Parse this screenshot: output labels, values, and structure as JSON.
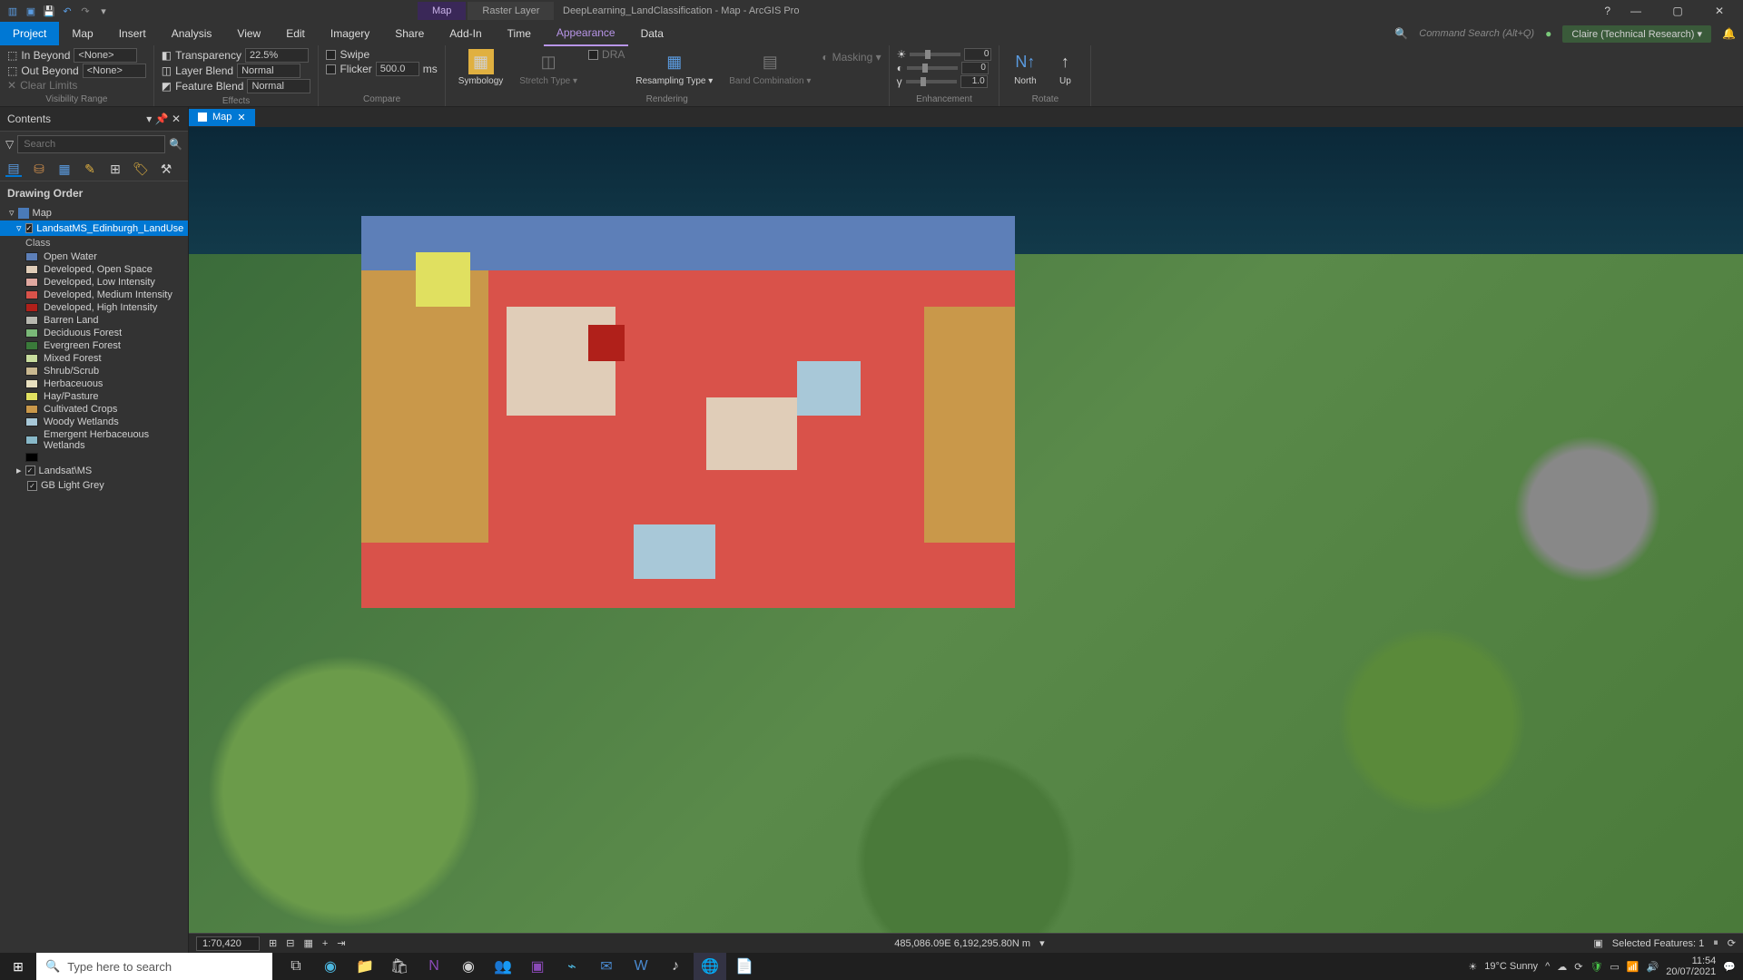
{
  "title": "DeepLearning_LandClassification - Map - ArcGIS Pro",
  "context_tabs": {
    "map": "Map",
    "raster": "Raster Layer"
  },
  "help_icon": "?",
  "user": "Claire (Technical Research) ▾",
  "command_search_placeholder": "Command Search (Alt+Q)",
  "menus": {
    "project": "Project",
    "map": "Map",
    "insert": "Insert",
    "analysis": "Analysis",
    "view": "View",
    "edit": "Edit",
    "imagery": "Imagery",
    "share": "Share",
    "addin": "Add-In",
    "time": "Time",
    "appearance": "Appearance",
    "data": "Data"
  },
  "ribbon": {
    "visibility": {
      "in_beyond": "In Beyond",
      "out_beyond": "Out Beyond",
      "none": "<None>",
      "clear": "Clear Limits",
      "group": "Visibility Range"
    },
    "effects": {
      "transparency": "Transparency",
      "transparency_val": "22.5%",
      "layer_blend": "Layer Blend",
      "feature_blend": "Feature Blend",
      "normal": "Normal",
      "group": "Effects"
    },
    "compare": {
      "swipe": "Swipe",
      "flicker": "Flicker",
      "flicker_val": "500.0",
      "ms": "ms",
      "group": "Compare"
    },
    "rendering": {
      "symbology": "Symbology",
      "stretch": "Stretch Type ▾",
      "dra": "DRA",
      "resampling": "Resampling Type ▾",
      "band": "Band Combination ▾",
      "masking": "Masking ▾",
      "group": "Rendering"
    },
    "enhancement": {
      "brightness": "0",
      "contrast": "0",
      "gamma": "1.0",
      "group": "Enhancement"
    },
    "rotate": {
      "north": "North",
      "up": "Up",
      "group": "Rotate"
    }
  },
  "contents": {
    "title": "Contents",
    "search_placeholder": "Search",
    "drawing_order": "Drawing Order",
    "map_node": "Map",
    "layer_selected": "LandsatMS_Edinburgh_LandUse",
    "class_header": "Class",
    "legend": [
      {
        "label": "Open Water",
        "color": "#5d7fb8"
      },
      {
        "label": "Developed, Open Space",
        "color": "#e0cdb8"
      },
      {
        "label": "Developed, Low Intensity",
        "color": "#e0a8a0"
      },
      {
        "label": "Developed, Medium Intensity",
        "color": "#d9524a"
      },
      {
        "label": "Developed, High Intensity",
        "color": "#b0201a"
      },
      {
        "label": "Barren Land",
        "color": "#b8b8b0"
      },
      {
        "label": "Deciduous Forest",
        "color": "#7ab878"
      },
      {
        "label": "Evergreen Forest",
        "color": "#3a7a3a"
      },
      {
        "label": "Mixed Forest",
        "color": "#c8dd9e"
      },
      {
        "label": "Shrub/Scrub",
        "color": "#c9b890"
      },
      {
        "label": "Herbaceuous",
        "color": "#e8e0c0"
      },
      {
        "label": "Hay/Pasture",
        "color": "#e0e060"
      },
      {
        "label": "Cultivated Crops",
        "color": "#c9984a"
      },
      {
        "label": "Woody Wetlands",
        "color": "#a8c8d8"
      },
      {
        "label": "Emergent Herbaceuous Wetlands",
        "color": "#88b8c8"
      }
    ],
    "black_swatch": "#000000",
    "layer2": "Landsat\\MS",
    "layer3": "GB Light Grey"
  },
  "view_tab": "Map",
  "time_button": "Time ▾",
  "status": {
    "scale": "1:70,420",
    "coords": "485,086.09E 6,192,295.80N m",
    "selected": "Selected Features: 1"
  },
  "taskbar": {
    "search_placeholder": "Type here to search",
    "weather": "19°C  Sunny",
    "time": "11:54",
    "date": "20/07/2021"
  }
}
